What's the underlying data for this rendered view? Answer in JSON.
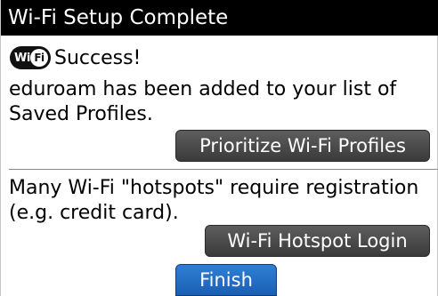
{
  "title": "Wi-Fi Setup Complete",
  "success": {
    "logo_text_left": "Wi",
    "logo_text_right": "Fi",
    "label": "Success!"
  },
  "saved_message": "eduroam has been added to your list of Saved Profiles.",
  "buttons": {
    "prioritize": "Prioritize Wi-Fi Profiles",
    "hotspot_login": "Wi-Fi Hotspot Login",
    "finish": "Finish"
  },
  "hotspot_message": "Many Wi-Fi \"hotspots\" require registration (e.g. credit card).",
  "colors": {
    "title_bar": "#000000",
    "button": "#4a4a4a",
    "focused_button": "#2468c4"
  }
}
